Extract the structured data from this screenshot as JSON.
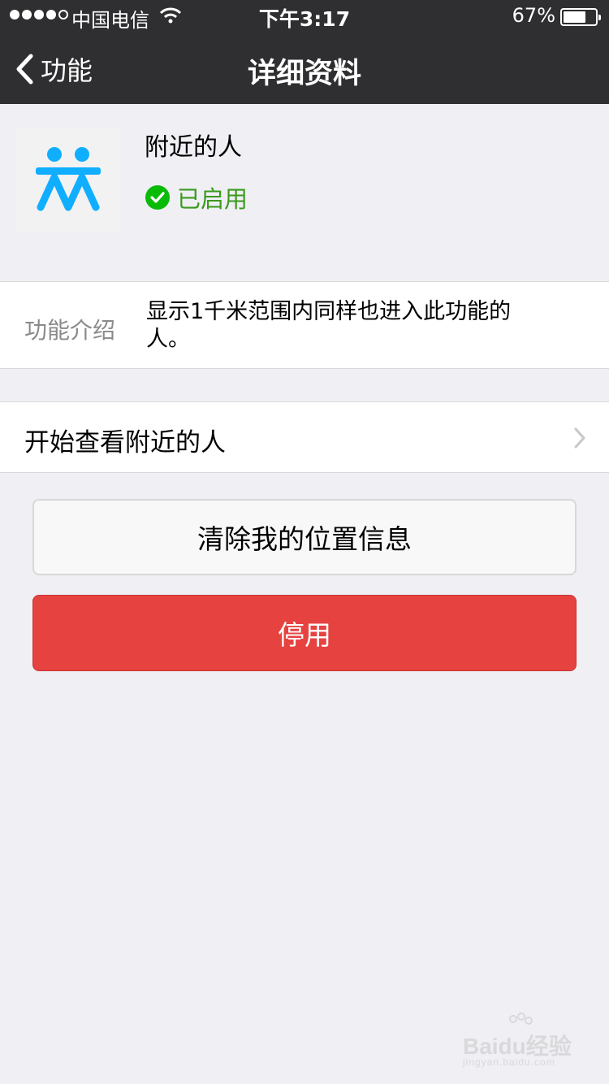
{
  "status_bar": {
    "carrier": "中国电信",
    "time": "下午3:17",
    "battery_percent": "67%",
    "battery_level": 0.67,
    "signal_bars_filled": 4,
    "signal_bars_total": 5
  },
  "nav": {
    "back_label": "功能",
    "title": "详细资料"
  },
  "profile": {
    "name": "附近的人",
    "status": "已启用",
    "icon": "people-nearby-icon",
    "icon_color": "#10aeff"
  },
  "intro": {
    "label": "功能介绍",
    "text": "显示1千米范围内同样也进入此功能的人。"
  },
  "cell": {
    "label": "开始查看附近的人"
  },
  "buttons": {
    "clear_label": "清除我的位置信息",
    "disable_label": "停用",
    "disable_color": "#e64340"
  },
  "watermark": {
    "brand": "Baidu经验",
    "url": "jingyan.baidu.com"
  },
  "colors": {
    "navbar": "#2f2f31",
    "background": "#efeff4",
    "success": "#09bb07"
  }
}
